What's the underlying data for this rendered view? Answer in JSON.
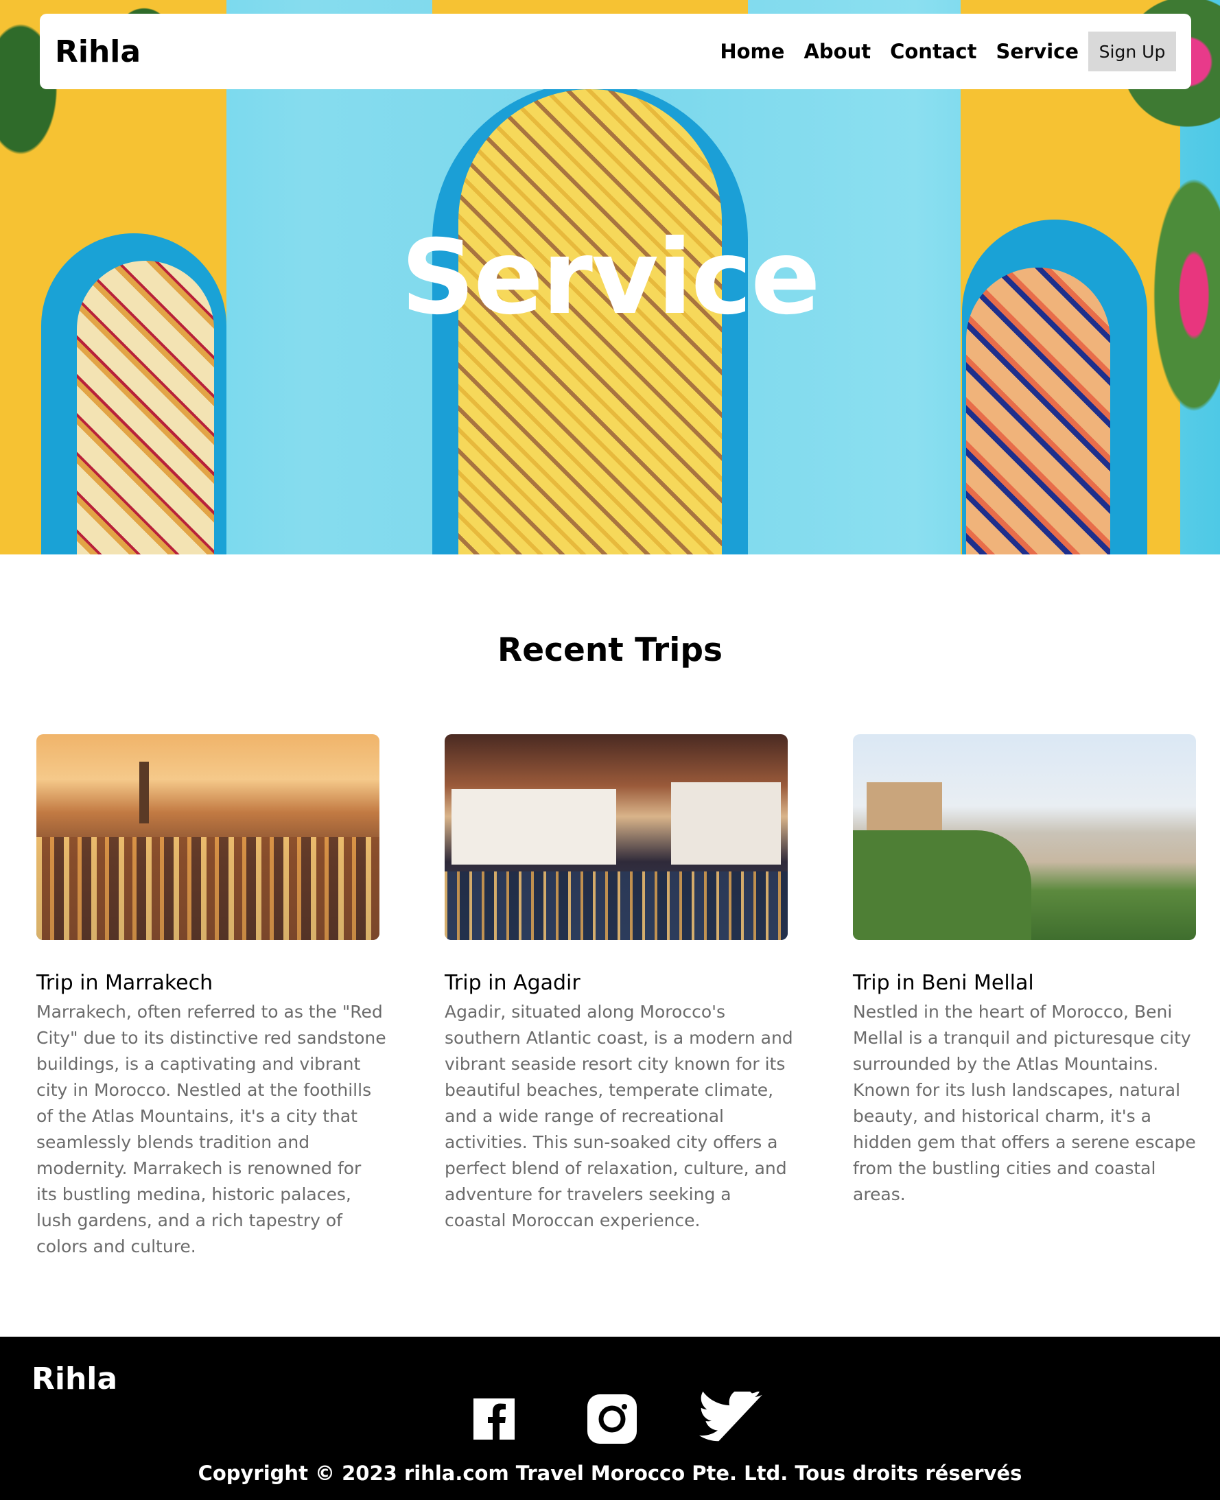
{
  "nav": {
    "brand": "Rihla",
    "links": [
      "Home",
      "About",
      "Contact",
      "Service"
    ],
    "signup_label": "Sign Up"
  },
  "hero": {
    "title": "Service"
  },
  "trips": {
    "heading": "Recent Trips",
    "cards": [
      {
        "title": "Trip in Marrakech",
        "text": "Marrakech, often referred to as the \"Red City\" due to its distinctive red sandstone buildings, is a captivating and vibrant city in Morocco. Nestled at the foothills of the Atlas Mountains, it's a city that seamlessly blends tradition and modernity. Marrakech is renowned for its bustling medina, historic palaces, lush gardens, and a rich tapestry of colors and culture."
      },
      {
        "title": "Trip in Agadir",
        "text": "Agadir, situated along Morocco's southern Atlantic coast, is a modern and vibrant seaside resort city known for its beautiful beaches, temperate climate, and a wide range of recreational activities. This sun-soaked city offers a perfect blend of relaxation, culture, and adventure for travelers seeking a coastal Moroccan experience."
      },
      {
        "title": "Trip in Beni Mellal",
        "text": "Nestled in the heart of Morocco, Beni Mellal is a tranquil and picturesque city surrounded by the Atlas Mountains. Known for its lush landscapes, natural beauty, and historical charm, it's a hidden gem that offers a serene escape from the bustling cities and coastal areas."
      }
    ]
  },
  "footer": {
    "brand": "Rihla",
    "social": [
      "facebook-icon",
      "instagram-icon",
      "twitter-icon"
    ],
    "copyright": "Copyright © 2023 rihla.com Travel Morocco Pte. Ltd. Tous droits réservés"
  },
  "colors": {
    "footer_bg": "#000000",
    "signup_bg": "#d9d9d9",
    "body_text": "#6b6b6b"
  }
}
